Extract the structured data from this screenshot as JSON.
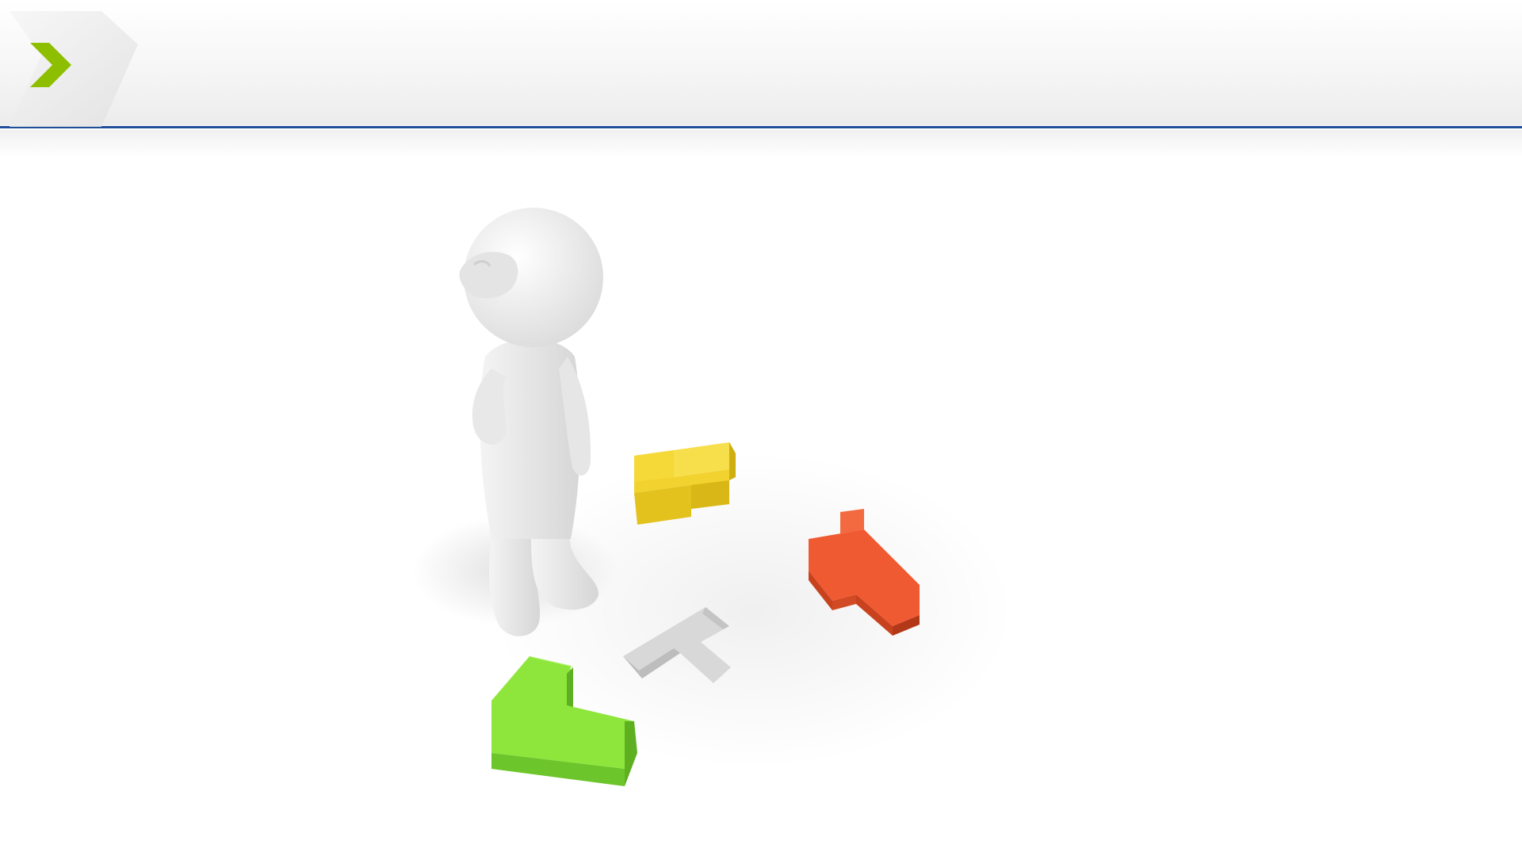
{
  "slide": {
    "title": ""
  },
  "colors": {
    "header_rule": "#1f4e9a",
    "chevron_accent": "#8dbf00",
    "chevron_backdrop": "#ededed",
    "figure_body": "#eeeeee",
    "block_yellow": "#f2d22e",
    "block_red": "#f05a32",
    "block_green": "#8ee63c",
    "slot_grey": "#d8d8d8"
  },
  "icons": {
    "header_mark": "chevron-right-icon",
    "illustration": "confused-figure-with-puzzle-blocks"
  }
}
